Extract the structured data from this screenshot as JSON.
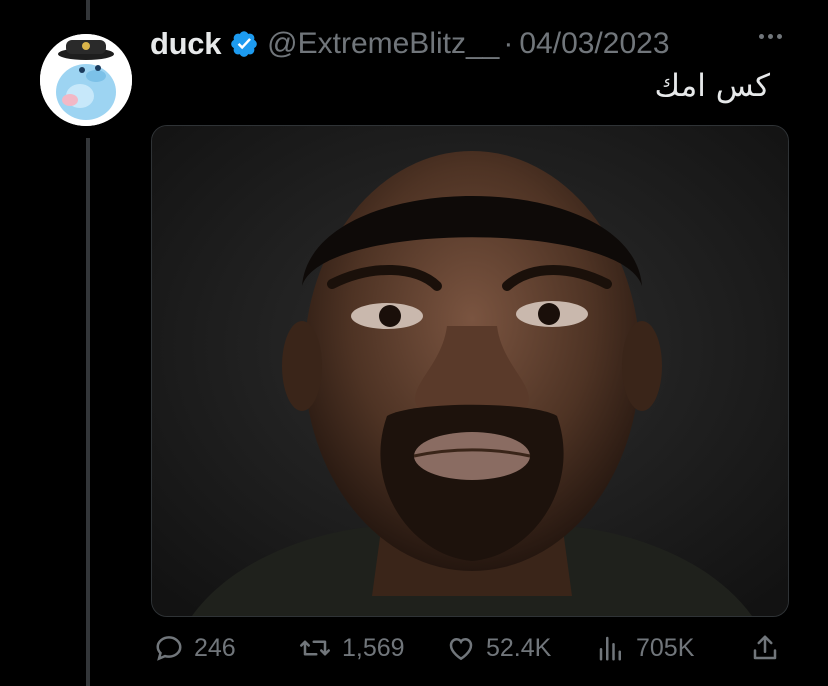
{
  "tweet": {
    "display_name": "duck",
    "handle": "@ExtremeBlitz__",
    "separator": "·",
    "date": "04/03/2023",
    "text": "كس امك"
  },
  "actions": {
    "replies": "246",
    "retweets": "1,569",
    "likes": "52.4K",
    "views": "705K"
  },
  "icons": {
    "verified": "verified-badge-icon",
    "more": "more-dots-icon",
    "reply": "reply-bubble-icon",
    "retweet": "retweet-arrows-icon",
    "like": "heart-icon",
    "views": "bar-chart-icon",
    "share": "share-upload-icon"
  },
  "colors": {
    "background": "#000000",
    "text": "#e7e9ea",
    "muted": "#71767b",
    "verified": "#1d9bf0"
  }
}
